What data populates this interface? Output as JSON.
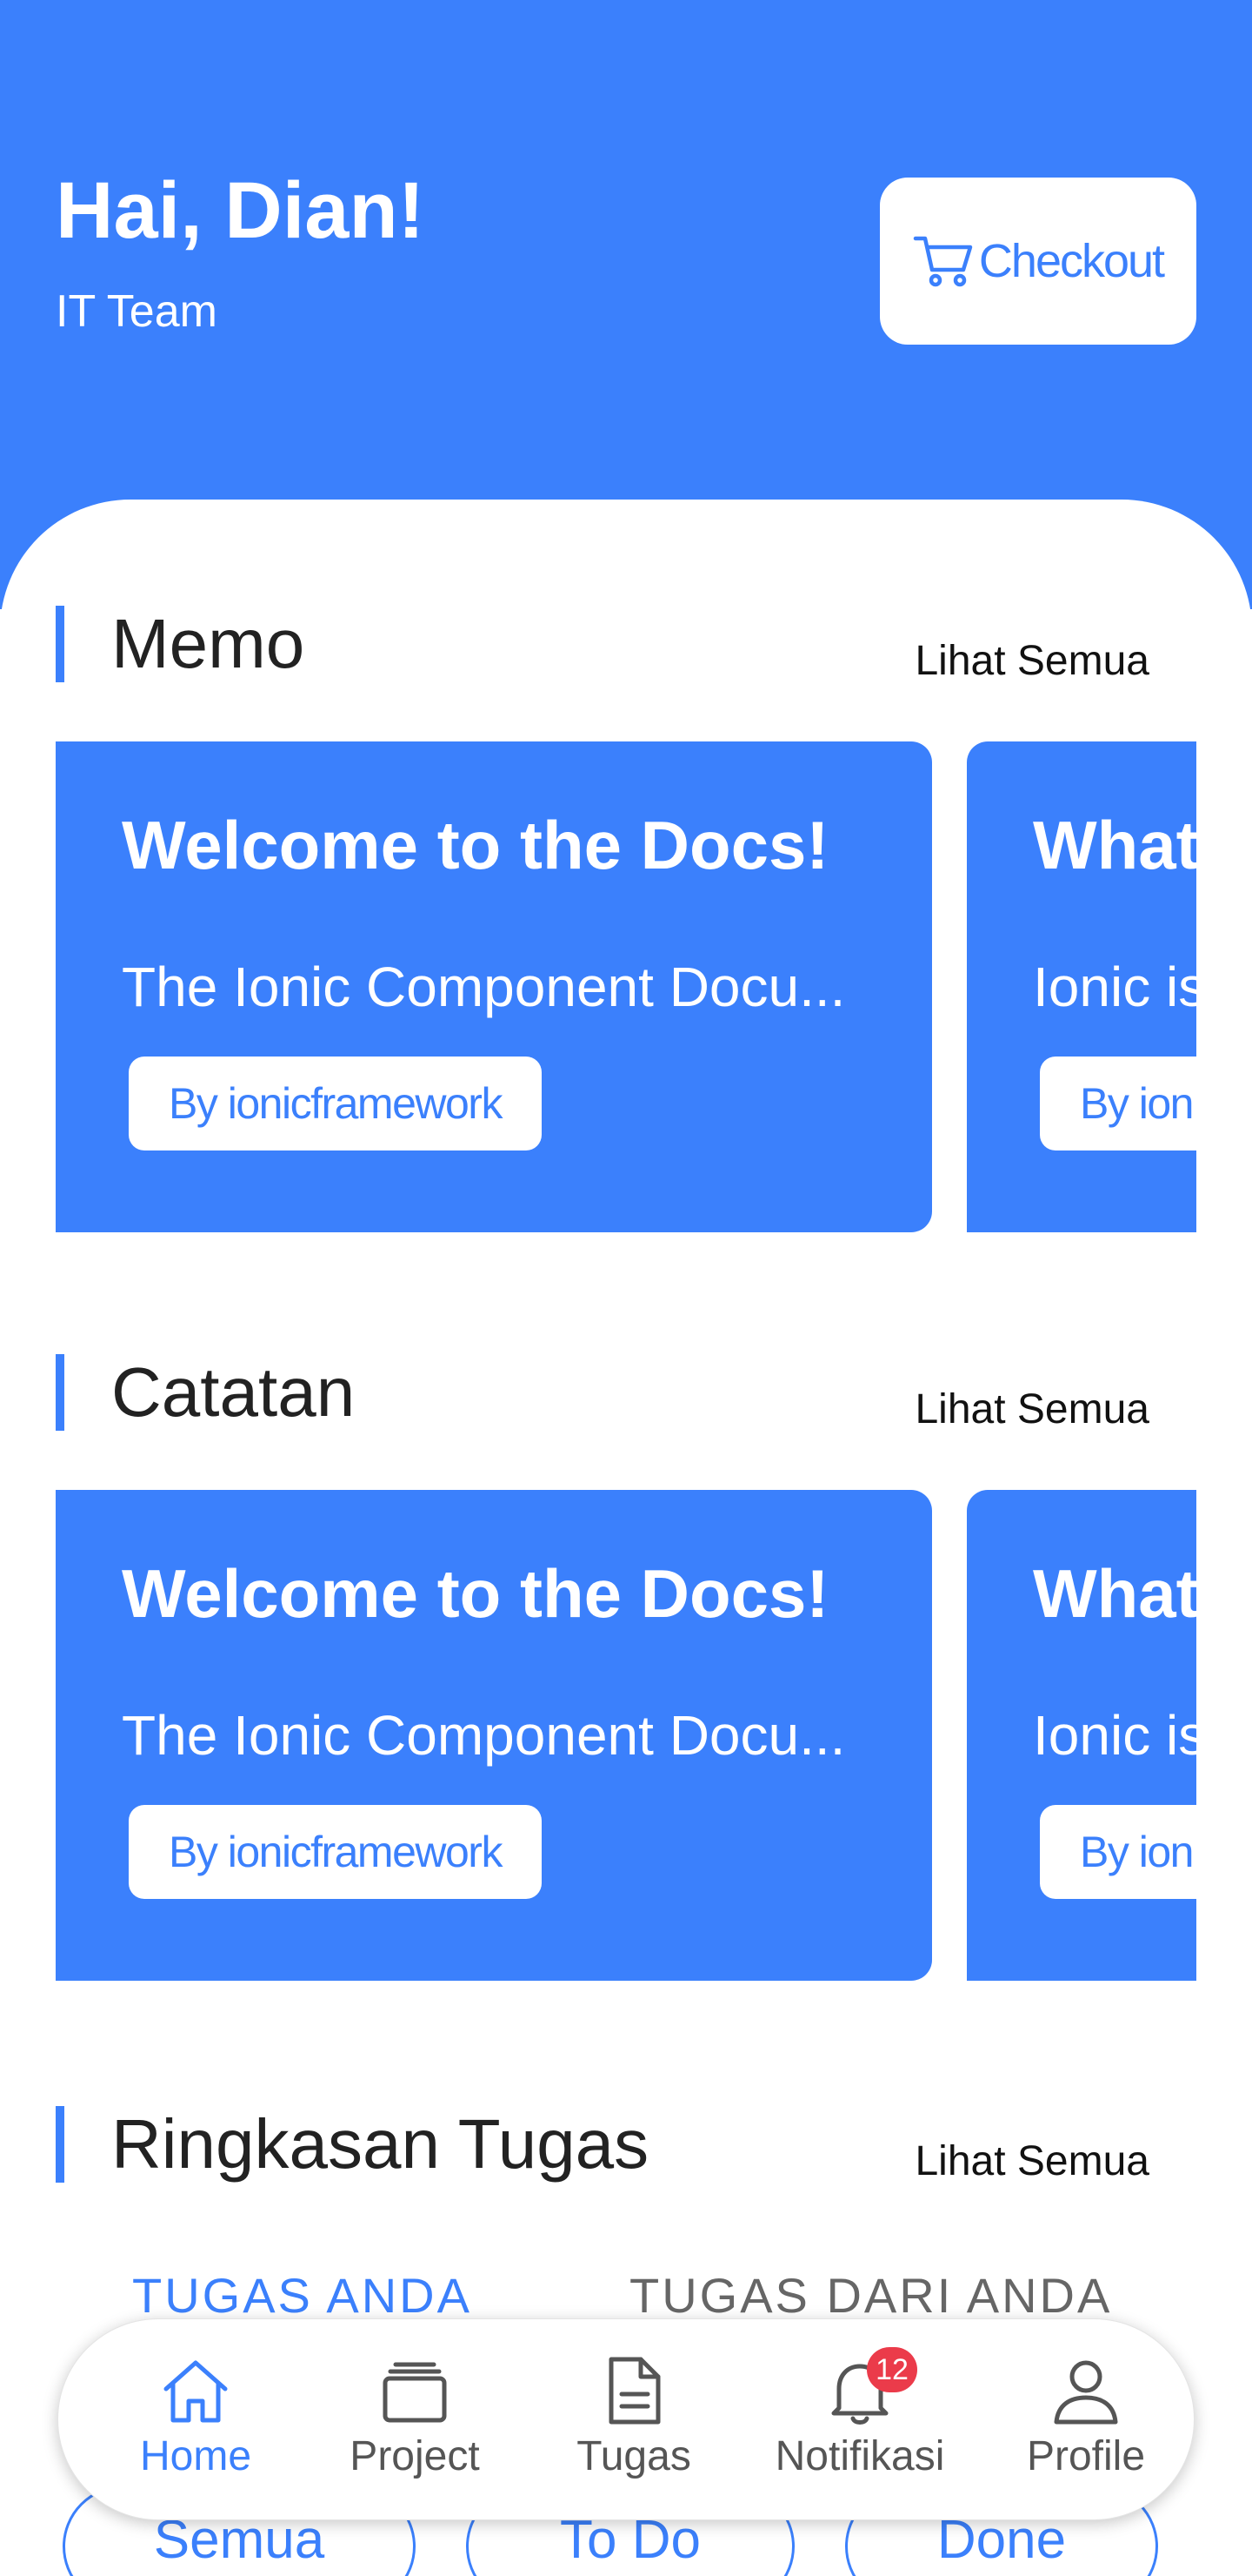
{
  "header": {
    "greeting": "Hai, Dian!",
    "team": "IT Team",
    "checkout_label": "Checkout"
  },
  "colors": {
    "primary": "#3b80fc",
    "badge": "#eb3b4a",
    "background": "#ffffff"
  },
  "sections": {
    "memo": {
      "title": "Memo",
      "see_all": "Lihat Semua",
      "cards": [
        {
          "title": "Welcome to the Docs!",
          "desc": "The Ionic Component Docu...",
          "author": "By ionicframework"
        },
        {
          "title": "What",
          "desc": "Ionic is",
          "author": "By ion"
        }
      ]
    },
    "catatan": {
      "title": "Catatan",
      "see_all": "Lihat Semua",
      "cards": [
        {
          "title": "Welcome to the Docs!",
          "desc": "The Ionic Component Docu...",
          "author": "By ionicframework"
        },
        {
          "title": "What",
          "desc": "Ionic is",
          "author": "By ion"
        }
      ]
    },
    "ringkasan": {
      "title": "Ringkasan Tugas",
      "see_all": "Lihat Semua",
      "tabs": [
        "TUGAS ANDA",
        "TUGAS DARI ANDA"
      ],
      "filters": [
        "Semua",
        "To Do",
        "Done"
      ]
    }
  },
  "tabbar": {
    "items": [
      {
        "label": "Home",
        "icon": "home-icon",
        "active": true
      },
      {
        "label": "Project",
        "icon": "layers-icon",
        "active": false
      },
      {
        "label": "Tugas",
        "icon": "document-icon",
        "active": false
      },
      {
        "label": "Notifikasi",
        "icon": "bell-icon",
        "active": false,
        "badge": "12"
      },
      {
        "label": "Profile",
        "icon": "person-icon",
        "active": false
      }
    ]
  }
}
